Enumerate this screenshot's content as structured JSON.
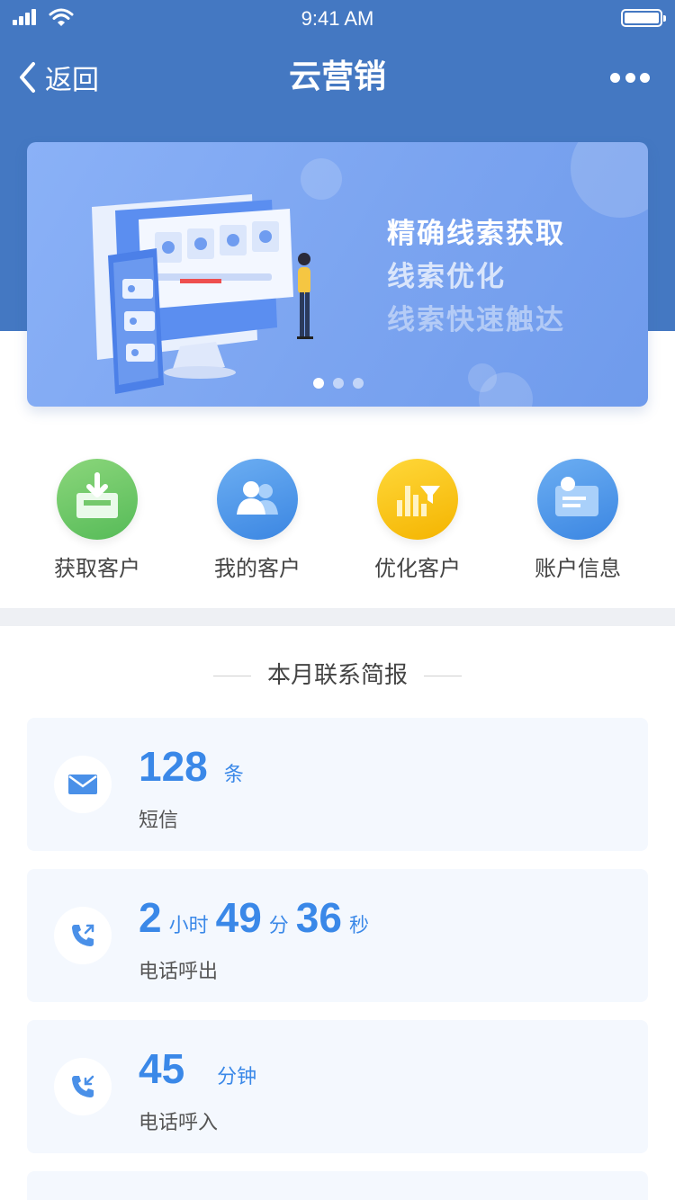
{
  "status_bar": {
    "time": "9:41 AM"
  },
  "nav": {
    "back_label": "返回",
    "title": "云营销"
  },
  "banner": {
    "lines": [
      "精确线索获取",
      "线索优化",
      "线索快速触达"
    ],
    "page_count": 3,
    "active_index": 0
  },
  "actions": [
    {
      "label": "获取客户",
      "icon": "inbox-download-icon",
      "color": "#6cc86a"
    },
    {
      "label": "我的客户",
      "icon": "users-icon",
      "color": "#4a94e8"
    },
    {
      "label": "优化客户",
      "icon": "chart-filter-icon",
      "color": "#f7c31a"
    },
    {
      "label": "账户信息",
      "icon": "id-card-icon",
      "color": "#4a94e8"
    }
  ],
  "report": {
    "title": "本月联系简报",
    "sms": {
      "value": "128",
      "unit": "条",
      "label": "短信"
    },
    "outgoing": {
      "hours": "2",
      "hours_unit": "小时",
      "minutes": "49",
      "minutes_unit": "分",
      "seconds": "36",
      "seconds_unit": "秒",
      "label": "电话呼出"
    },
    "incoming": {
      "value": "45",
      "unit": "分钟",
      "label": "电话呼入"
    }
  },
  "colors": {
    "header_blue": "#4478c2",
    "accent_blue": "#3a88e8",
    "card_bg": "#f4f8fe"
  }
}
